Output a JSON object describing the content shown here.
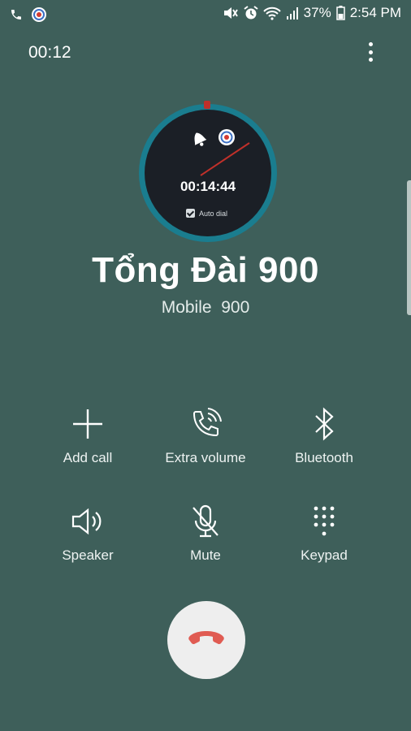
{
  "status_bar": {
    "battery": "37%",
    "time": "2:54 PM",
    "icons_left": [
      "phone-icon",
      "app-notification-icon"
    ],
    "icons_right": [
      "mute-icon",
      "alarm-icon",
      "wifi-icon",
      "signal-icon",
      "battery-icon"
    ]
  },
  "call": {
    "elapsed": "00:12",
    "contact_name": "Tổng Đài 900",
    "contact_detail": "Mobile  900"
  },
  "widget": {
    "timer": "00:14:44",
    "auto_dial_label": "Auto dial",
    "auto_dial_checked": true,
    "accent_color": "#1a7d8f",
    "hand_color": "#c0302a"
  },
  "controls": [
    {
      "label": "Add call",
      "icon": "plus-icon"
    },
    {
      "label": "Extra volume",
      "icon": "phone-volume-icon"
    },
    {
      "label": "Bluetooth",
      "icon": "bluetooth-icon"
    },
    {
      "label": "Speaker",
      "icon": "speaker-icon"
    },
    {
      "label": "Mute",
      "icon": "mic-off-icon"
    },
    {
      "label": "Keypad",
      "icon": "keypad-icon"
    }
  ],
  "colors": {
    "background": "#3e5f5a",
    "end_call_button": "#eeeeee",
    "end_call_icon": "#e05b52"
  }
}
